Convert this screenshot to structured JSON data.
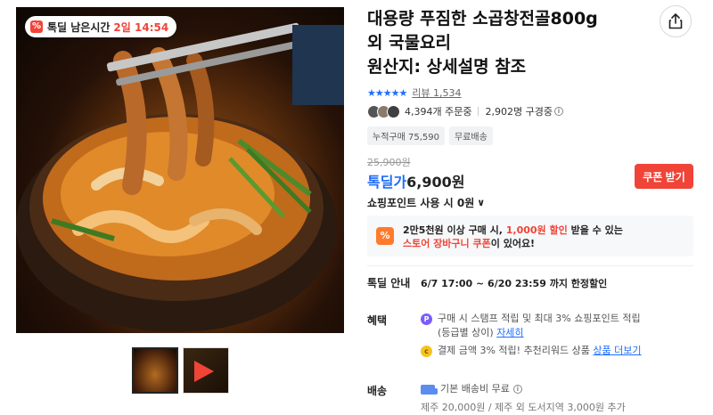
{
  "deal_badge": {
    "icon": "percent-icon",
    "label": "톡딜 남은시간",
    "timer": "2일 14:54"
  },
  "product": {
    "title": "대용량 푸짐한 소곱창전골800g\n외 국물요리\n원산지: 상세설명 참조",
    "rating_stars": "★★★★★",
    "review_label": "리뷰 1,534",
    "orders": "4,394개 주문중",
    "viewers": "2,902명 구경중",
    "tags": [
      "누적구매 75,590",
      "무료배송"
    ],
    "original_price": "25,900원",
    "deal_label": "톡딜가",
    "deal_price": "6,900원",
    "coupon_button": "쿠폰 받기",
    "points_label": "쇼핑포인트 사용 시 0원"
  },
  "promo": {
    "line1_a": "2만5천원 이상 구매 시, ",
    "line1_hl": "1,000원 할인",
    "line1_b": " 받을 수 있는",
    "line2_hl": "스토어 장바구니 쿠폰",
    "line2_b": "이 있어요!"
  },
  "deal_info": {
    "label": "톡딜 안내",
    "period": "6/7 17:00 ~ 6/20 23:59 까지 한정할인"
  },
  "benefits": {
    "label": "혜택",
    "item1_line1": "구매 시 스탬프 적립 및 최대 3% 쇼핑포인트 적립",
    "item1_line2": "(등급별 상이) ",
    "item1_link": "자세히",
    "item2": "결제 금액 3% 적립! 추천리워드 상품 ",
    "item2_link": "상품 더보기"
  },
  "shipping": {
    "label": "배송",
    "main": "기본 배송비 무료",
    "sub": "제주 20,000원 / 제주 외 도서지역 3,000원 추가"
  },
  "colors": {
    "accent_red": "#f04438",
    "accent_blue": "#1e6dff"
  }
}
